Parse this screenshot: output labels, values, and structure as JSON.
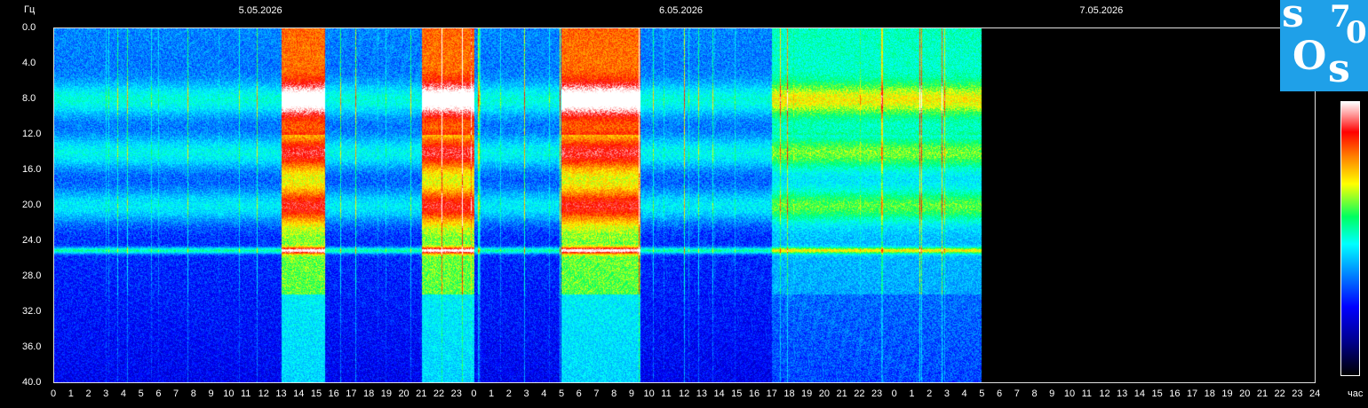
{
  "chart_data": {
    "type": "heatmap",
    "ylabel": "Гц",
    "xlabel": "час",
    "date_labels": [
      "5.05.2026",
      "6.05.2026",
      "7.05.2026"
    ],
    "y_ticks": [
      "0.0",
      "4.0",
      "8.0",
      "12.0",
      "16.0",
      "20.0",
      "24.0",
      "28.0",
      "32.0",
      "36.0",
      "40.0"
    ],
    "y_range": [
      0,
      40
    ],
    "x_ticks": [
      "0",
      "1",
      "2",
      "3",
      "4",
      "5",
      "6",
      "7",
      "8",
      "9",
      "10",
      "11",
      "12",
      "13",
      "14",
      "15",
      "16",
      "17",
      "18",
      "19",
      "20",
      "21",
      "22",
      "23",
      "0",
      "1",
      "2",
      "3",
      "4",
      "5",
      "6",
      "7",
      "8",
      "9",
      "10",
      "11",
      "12",
      "13",
      "14",
      "15",
      "16",
      "17",
      "18",
      "19",
      "20",
      "21",
      "22",
      "23",
      "0",
      "1",
      "2",
      "3",
      "4",
      "5",
      "6",
      "7",
      "8",
      "9",
      "10",
      "11",
      "12",
      "13",
      "14",
      "15",
      "16",
      "17",
      "18",
      "19",
      "20",
      "21",
      "22",
      "23",
      "24"
    ],
    "x_range_hours": [
      0,
      72
    ],
    "data_end_hour": 53,
    "resonance_bands_hz": [
      8,
      14,
      20,
      25
    ],
    "high_activity_hours": [
      [
        13,
        15.5
      ],
      [
        21,
        24
      ],
      [
        29,
        33.5
      ]
    ],
    "colorscale": [
      "#000000",
      "#00008a",
      "#0000ff",
      "#0090ff",
      "#00ffff",
      "#00ff60",
      "#ffff00",
      "#ff8000",
      "#ff0000",
      "#ffffff"
    ]
  },
  "logo": {
    "chars": [
      "s",
      "7",
      "0",
      "O",
      "s"
    ],
    "background": "#1fa0e8"
  }
}
